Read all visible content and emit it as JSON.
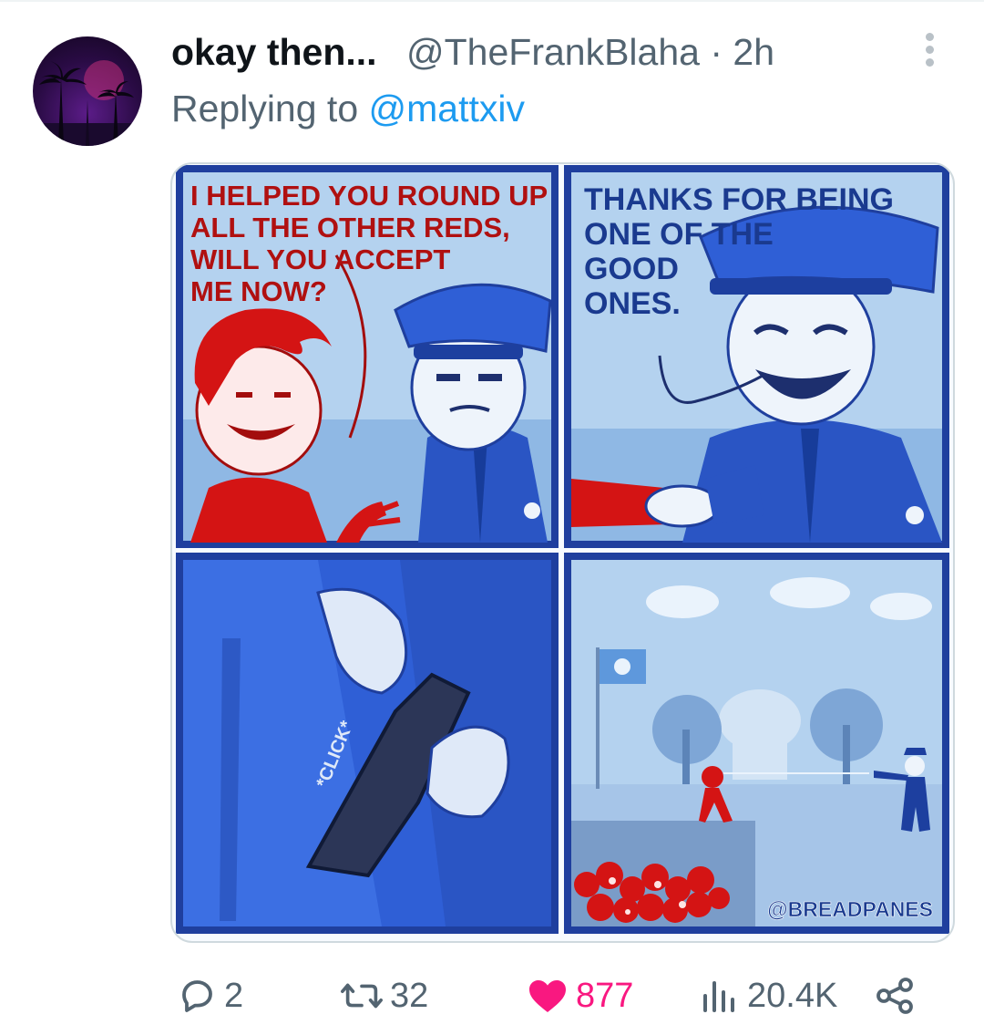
{
  "tweet": {
    "display_name": "okay then...",
    "handle": "@TheFrankBlaha",
    "time": "· 2h",
    "replying_prefix": "Replying to",
    "replying_to": "@mattxiv"
  },
  "comic": {
    "panel1_line1": "I HELPED YOU ROUND UP",
    "panel1_line2": "ALL THE OTHER REDS,",
    "panel1_line3": "WILL YOU ACCEPT",
    "panel1_line4": "ME NOW?",
    "panel2_line1": "THANKS FOR BEING",
    "panel2_line2": "ONE OF THE",
    "panel2_line3": "GOOD",
    "panel2_line4": "ONES.",
    "panel3_sfx": "*CLICK*",
    "credit": "@BREADPANES"
  },
  "actions": {
    "replies": "2",
    "reposts": "32",
    "likes": "877",
    "views": "20.4K"
  },
  "icons": [
    "more-icon",
    "reply-icon",
    "repost-icon",
    "heart-icon",
    "views-icon",
    "share-icon"
  ],
  "colors": {
    "text": "#0f1419",
    "secondary": "#536471",
    "link": "#1d9bf0",
    "like": "#f91880",
    "comic_blue": "#2148b8",
    "comic_red": "#d41414"
  }
}
